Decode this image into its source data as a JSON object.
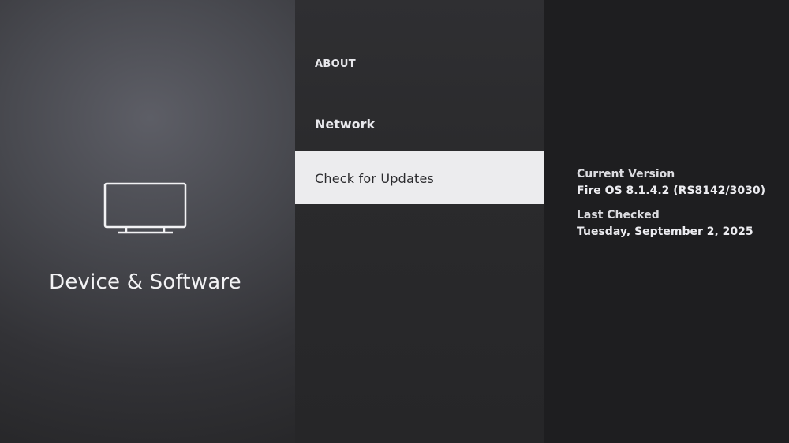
{
  "left": {
    "icon": "tv-icon",
    "title": "Device & Software"
  },
  "menu": {
    "items": [
      {
        "label": "ABOUT"
      },
      {
        "label": "Network"
      },
      {
        "label": "Check for Updates",
        "selected": true
      }
    ]
  },
  "details": {
    "current_version_label": "Current Version",
    "current_version_value": "Fire OS 8.1.4.2 (RS8142/3030)",
    "last_checked_label": "Last Checked",
    "last_checked_value": "Tuesday, September 2, 2025"
  },
  "colors": {
    "selected_background": "#ececee",
    "panel_dark": "#1e1e20"
  }
}
